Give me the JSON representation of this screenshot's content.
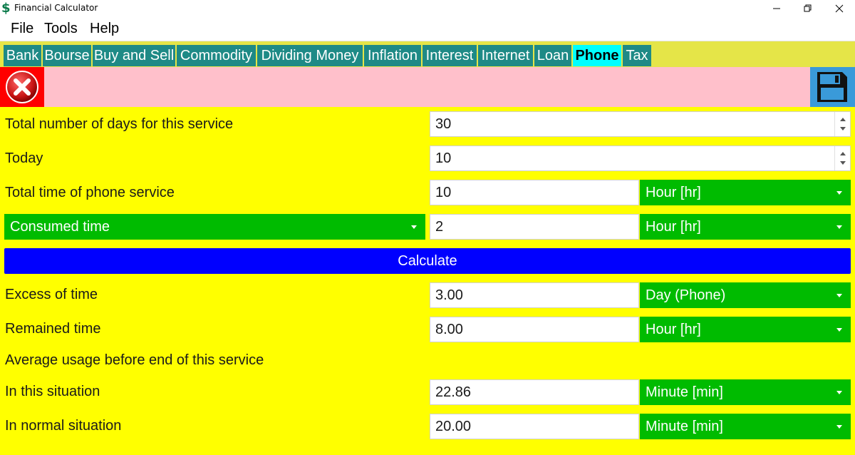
{
  "window": {
    "title": "Financial Calculator",
    "app_icon_glyph": "$"
  },
  "menu": {
    "file": "File",
    "tools": "Tools",
    "help": "Help"
  },
  "tabs": [
    {
      "label": "Bank"
    },
    {
      "label": "Bourse"
    },
    {
      "label": "Buy and Sell"
    },
    {
      "label": "Commodity"
    },
    {
      "label": "Dividing Money"
    },
    {
      "label": "Inflation"
    },
    {
      "label": "Interest"
    },
    {
      "label": "Internet"
    },
    {
      "label": "Loan"
    },
    {
      "label": "Phone",
      "active": true
    },
    {
      "label": "Tax"
    }
  ],
  "toolbar": {
    "close_icon": "close-circle-icon",
    "save_icon": "floppy-disk-icon"
  },
  "form": {
    "total_days_label": "Total number of days for this service",
    "total_days_value": "30",
    "today_label": "Today",
    "today_value": "10",
    "total_time_label": "Total time of phone service",
    "total_time_value": "10",
    "total_time_unit": "Hour [hr]",
    "consumed_mode": "Consumed time",
    "consumed_value": "2",
    "consumed_unit": "Hour [hr]",
    "calculate": "Calculate",
    "excess_label": "Excess of time",
    "excess_value": "3.00",
    "excess_unit": "Day (Phone)",
    "remained_label": "Remained time",
    "remained_value": "8.00",
    "remained_unit": "Hour [hr]",
    "average_heading": "Average usage before end of this service",
    "this_situation_label": "In this situation",
    "this_situation_value": "22.86",
    "this_situation_unit": "Minute [min]",
    "normal_situation_label": "In normal situation",
    "normal_situation_value": "20.00",
    "normal_situation_unit": "Minute [min]"
  },
  "colors": {
    "tab_bg": "#1e8a86",
    "tab_active_bg": "#00ffff",
    "main_bg": "#ffff00",
    "toolbar_bg": "#ffc0cb",
    "select_bg": "#00bb00",
    "calculate_bg": "#0000ff"
  }
}
